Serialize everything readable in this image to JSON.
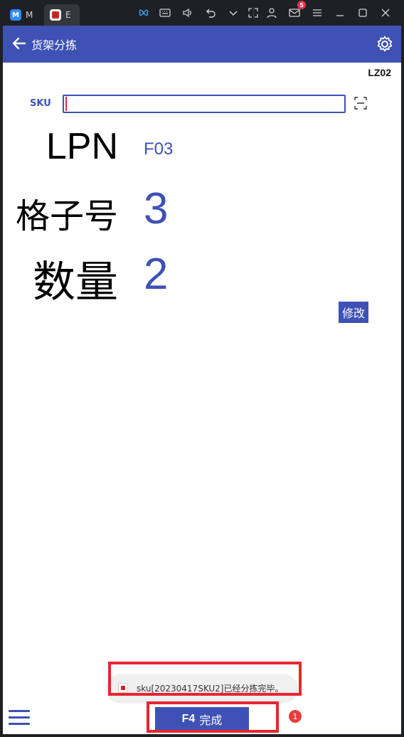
{
  "window": {
    "tab1_label": "M",
    "tab1_icon_letter": "M",
    "tab2_label": "E",
    "mail_badge": "5"
  },
  "appbar": {
    "title": "货架分拣"
  },
  "device_code": "LZ02",
  "sku": {
    "label": "SKU",
    "value": ""
  },
  "rows": {
    "lpn_label": "LPN",
    "lpn_value": "F03",
    "grid_label": "格子号",
    "grid_value": "3",
    "qty_label": "数量",
    "qty_value": "2"
  },
  "edit_button": "修改",
  "toast": {
    "message": "sku[20230417SKU2]已经分拣完毕。"
  },
  "done_button": {
    "key": "F4",
    "label": "完成"
  },
  "error_badge": "1",
  "colors": {
    "primary": "#3e51b5",
    "highlight": "#e8262e",
    "badge": "#e53e3e"
  }
}
